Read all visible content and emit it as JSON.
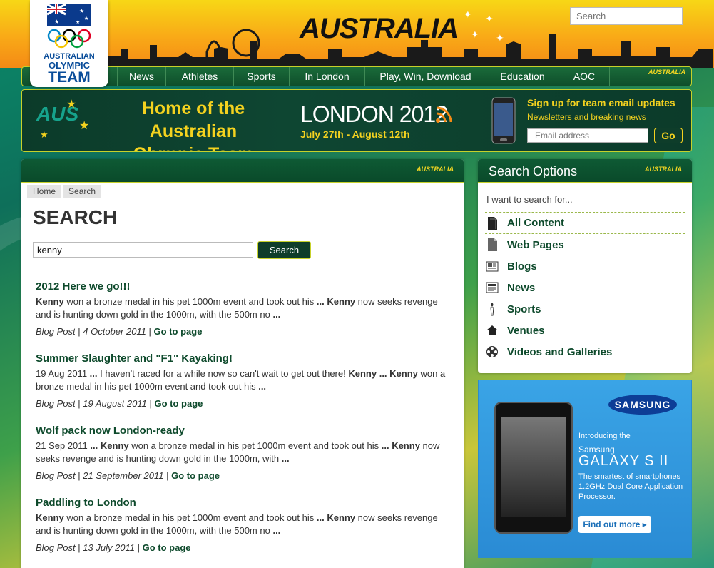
{
  "header": {
    "site_title": "AUSTRALIA",
    "search_placeholder": "Search"
  },
  "logo": {
    "line1": "AUSTRALIAN",
    "line2": "OLYMPIC",
    "line3": "TEAM"
  },
  "nav": {
    "items": [
      "News",
      "Athletes",
      "Sports",
      "In London",
      "Play, Win, Download",
      "Education",
      "AOC"
    ],
    "badge": "AUSTRALIA"
  },
  "banner": {
    "aus_mark": "AUS",
    "home_line1": "Home of the Australian",
    "home_line2": "Olympic Team",
    "london": "LONDON 2012",
    "dates": "July 27th - August 12th",
    "signup_title": "Sign up for team email updates",
    "signup_sub": "Newsletters and breaking news",
    "email_placeholder": "Email address",
    "go_label": "Go"
  },
  "main": {
    "badge": "AUSTRALIA",
    "breadcrumb": [
      "Home",
      "Search"
    ],
    "title": "SEARCH",
    "search_value": "kenny",
    "search_button": "Search",
    "results": [
      {
        "title": "2012 Here we go!!!",
        "snippet_html": "<b>Kenny</b> won a bronze medal in his pet 1000m event and took out his <b>...</b> <b>Kenny</b> now seeks revenge and is hunting down gold in the 1000m, with the 500m no <b>...</b>",
        "type": "Blog Post",
        "date": "4 October 2011",
        "link": "Go to page"
      },
      {
        "title": "Summer Slaughter and \"F1\" Kayaking!",
        "snippet_html": "19 Aug 2011 <b>...</b> I haven't raced for a while now so can't wait to get out there! <b>Kenny</b> <b>...</b> <b>Kenny</b> won a bronze medal in his pet 1000m event and took out his <b>...</b>",
        "type": "Blog Post",
        "date": "19 August 2011",
        "link": "Go to page"
      },
      {
        "title": "Wolf pack now London-ready",
        "snippet_html": "21 Sep 2011 <b>...</b> <b>Kenny</b> won a bronze medal in his pet 1000m event and took out his <b>...</b> <b>Kenny</b> now seeks revenge and is hunting down gold in the 1000m, with <b>...</b>",
        "type": "Blog Post",
        "date": "21 September 2011",
        "link": "Go to page"
      },
      {
        "title": "Paddling to London",
        "snippet_html": "<b>Kenny</b> won a bronze medal in his pet 1000m event and took out his <b>...</b> <b>Kenny</b> now seeks revenge and is hunting down gold in the 1000m, with the 500m no <b>...</b>",
        "type": "Blog Post",
        "date": "13 July 2011",
        "link": "Go to page"
      }
    ]
  },
  "sidebar": {
    "title": "Search Options",
    "badge": "AUSTRALIA",
    "subtitle": "I want to search for...",
    "options": [
      {
        "label": "All Content",
        "icon": "document-icon"
      },
      {
        "label": "Web Pages",
        "icon": "page-icon"
      },
      {
        "label": "Blogs",
        "icon": "blog-icon"
      },
      {
        "label": "News",
        "icon": "newspaper-icon"
      },
      {
        "label": "Sports",
        "icon": "torch-icon"
      },
      {
        "label": "Venues",
        "icon": "home-icon"
      },
      {
        "label": "Videos and Galleries",
        "icon": "film-reel-icon"
      }
    ]
  },
  "ad": {
    "brand": "SAMSUNG",
    "intro": "Introducing the",
    "model_line1": "Samsung",
    "model_line2": "GALAXY S II",
    "description": "The smartest of smartphones 1.2GHz Dual Core Application Processor.",
    "cta": "Find out more"
  },
  "colors": {
    "brand_green": "#0e4a2c",
    "brand_yellow": "#f4d21f",
    "header_orange": "#f48a15"
  }
}
